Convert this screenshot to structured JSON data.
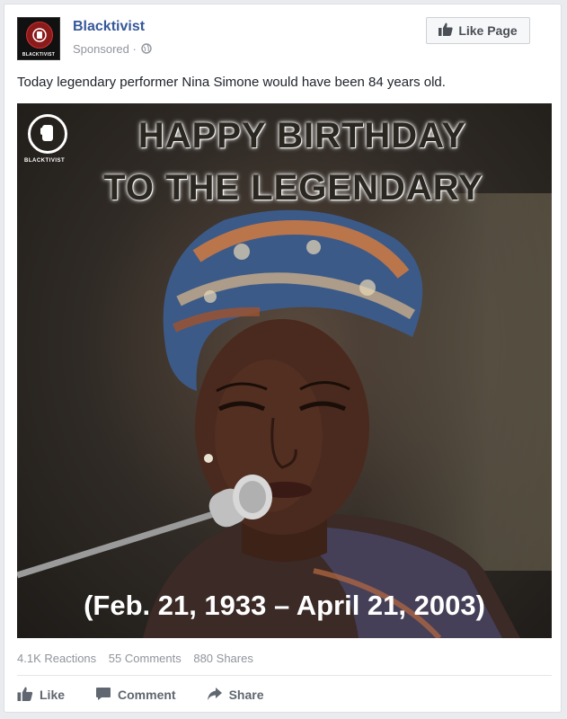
{
  "post": {
    "page_name": "Blacktivist",
    "sponsored_label": "Sponsored",
    "separator": "·",
    "like_page_label": "Like Page",
    "text": "Today legendary performer Nina Simone would have been 84 years old."
  },
  "avatar": {
    "brand_text": "BLACKTIVIST"
  },
  "image": {
    "headline_line1": "HAPPY BIRTHDAY",
    "headline_line2": "TO THE LEGENDARY",
    "dates": "(Feb. 21, 1933 – April 21, 2003)",
    "logo_text": "BLACKTIVIST"
  },
  "stats": {
    "reactions": "4.1K Reactions",
    "comments": "55 Comments",
    "shares": "880 Shares"
  },
  "actions": {
    "like": "Like",
    "comment": "Comment",
    "share": "Share"
  },
  "colors": {
    "link_blue": "#365899",
    "meta_gray": "#90949c",
    "action_gray": "#606770",
    "avatar_red": "#8b1a1a"
  }
}
